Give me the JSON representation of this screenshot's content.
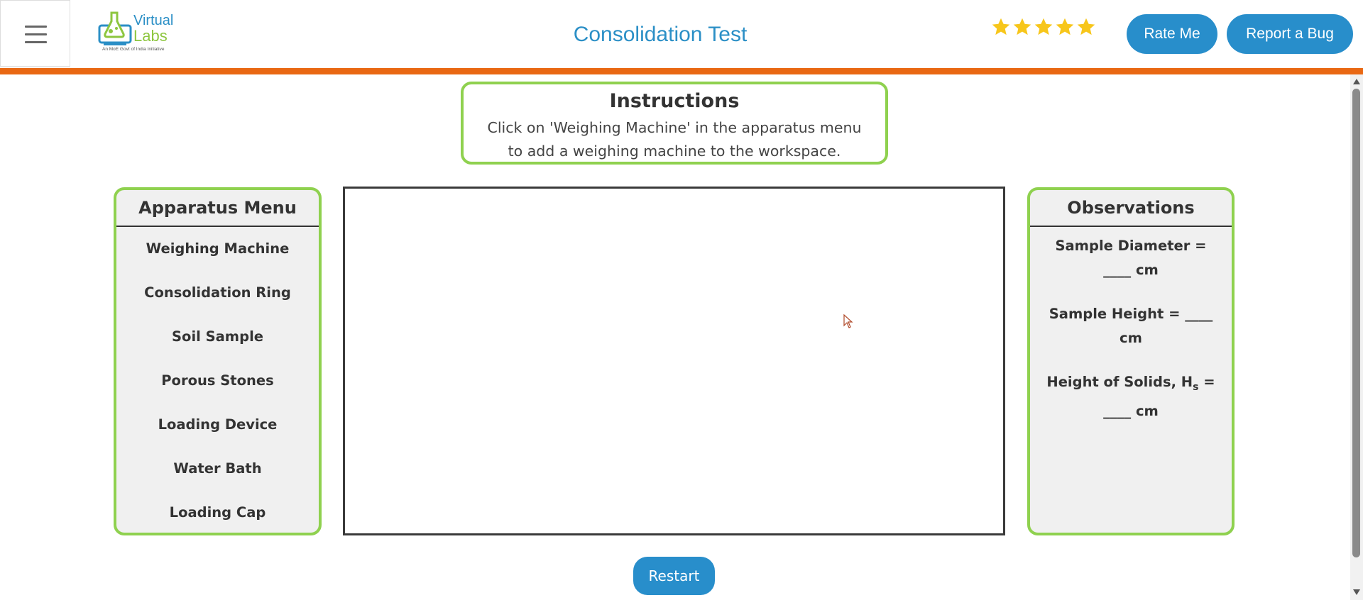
{
  "header": {
    "logo": {
      "line1": "Virtual",
      "line2": "Labs",
      "tagline": "An MoE Govt of India Initiative"
    },
    "title": "Consolidation Test",
    "rating_stars": 5,
    "rate_label": "Rate Me",
    "bug_label": "Report a Bug"
  },
  "instructions": {
    "heading": "Instructions",
    "text": "Click on 'Weighing Machine' in the apparatus menu to add a weighing machine to the workspace."
  },
  "apparatus": {
    "title": "Apparatus Menu",
    "items": [
      {
        "label": "Weighing Machine"
      },
      {
        "label": "Consolidation Ring"
      },
      {
        "label": "Soil Sample"
      },
      {
        "label": "Porous Stones"
      },
      {
        "label": "Loading Device"
      },
      {
        "label": "Water Bath"
      },
      {
        "label": "Loading Cap"
      }
    ]
  },
  "observations": {
    "title": "Observations",
    "diameter": "Sample Diameter = ____ cm",
    "height": "Sample Height = ____ cm",
    "solids_prefix": "Height of Solids, H",
    "solids_sub": "s",
    "solids_suffix": " = ____ cm"
  },
  "restart_label": "Restart",
  "colors": {
    "accent_blue": "#288ecb",
    "panel_border": "#8fd14f",
    "header_bar": "#e96813"
  }
}
